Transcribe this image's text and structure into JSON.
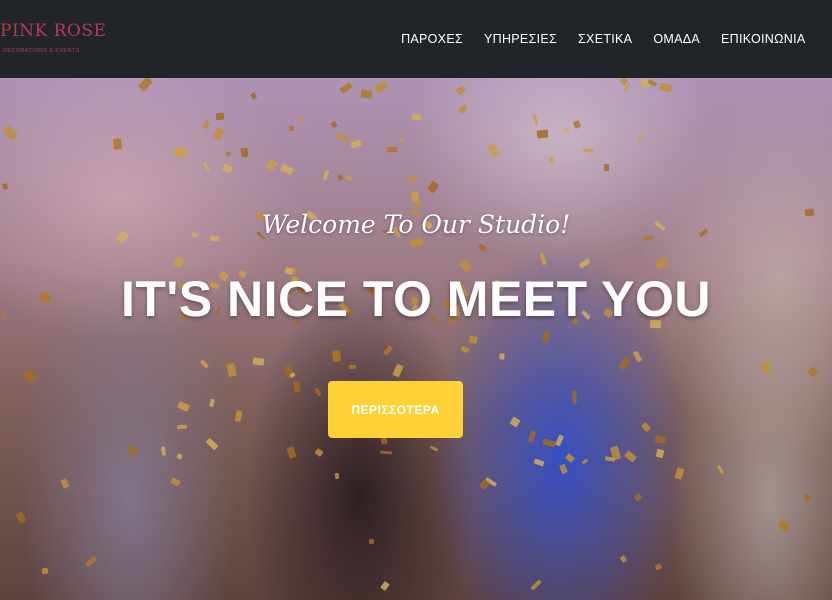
{
  "brand": {
    "name": "PINK ROSE",
    "tagline": "DECORATIONS & EVENTS"
  },
  "nav": {
    "items": [
      {
        "label": "ΠΑΡΟΧΕΣ"
      },
      {
        "label": "ΥΠΗΡΕΣΙΕΣ"
      },
      {
        "label": "ΣΧΕΤΙΚΑ"
      },
      {
        "label": "ΟΜΑΔΑ"
      },
      {
        "label": "ΕΠΙΚΟΙΝΩΝΙΑ"
      }
    ]
  },
  "hero": {
    "subheading": "Welcome To Our Studio!",
    "heading": "IT'S NICE TO MEET YOU",
    "cta_label": "ΠΕΡΙΣΣΟΤΕΡΑ"
  },
  "colors": {
    "navbar_bg": "#212529",
    "brand": "#b83a57",
    "cta_bg": "#fed136",
    "nav_text": "#ffffff"
  }
}
